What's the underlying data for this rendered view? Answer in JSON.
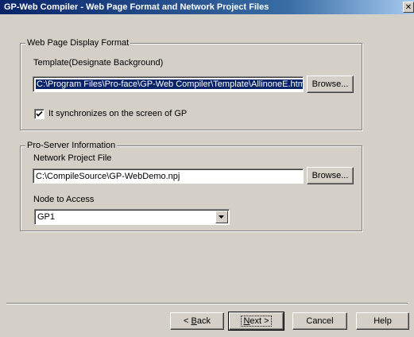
{
  "window": {
    "title": "GP-Web Compiler  -  Web Page Format and Network Project Files",
    "close_glyph": "✕"
  },
  "display_format": {
    "group_label": "Web Page Display Format",
    "template_label": "Template(Designate Background)",
    "template_path": "C:\\Program Files\\Pro-face\\GP-Web Compiler\\Template\\AllinoneE.htm",
    "browse_label": "Browse...",
    "sync_label": "It synchronizes on the screen of GP",
    "sync_checked": true
  },
  "pro_server": {
    "group_label": "Pro-Server Information",
    "project_label": "Network Project File",
    "project_path": "C:\\CompileSource\\GP-WebDemo.npj",
    "browse_label": "Browse...",
    "node_label": "Node to Access",
    "node_value": "GP1"
  },
  "footer": {
    "back_prefix": "< ",
    "back_key": "B",
    "back_rest": "ack",
    "next_key": "N",
    "next_rest": "ext >",
    "cancel_label": "Cancel",
    "help_label": "Help"
  }
}
